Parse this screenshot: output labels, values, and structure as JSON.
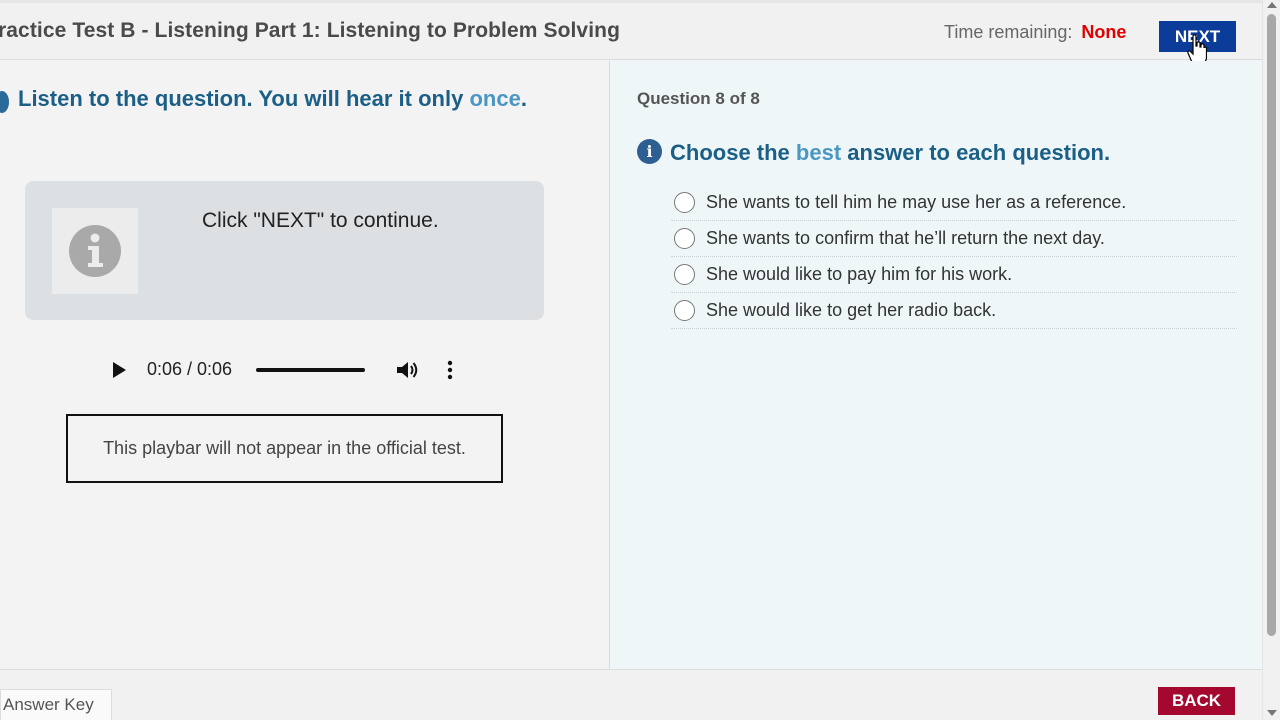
{
  "header": {
    "title": "ractice Test B - Listening Part 1: Listening to Problem Solving",
    "time_label": "Time remaining:",
    "time_value": "None",
    "next_label": "NEXT"
  },
  "left": {
    "instruction_prefix": "Listen to the question. You will hear it only ",
    "instruction_highlight": "once",
    "instruction_suffix": ".",
    "info_box_text": "Click \"NEXT\" to continue.",
    "audio_time": "0:06 / 0:06",
    "audio_progress": 1.0,
    "playbar_note": "This playbar will not appear in the official test."
  },
  "right": {
    "question_counter": "Question 8 of 8",
    "choose_prefix": "Choose the ",
    "choose_highlight": "best",
    "choose_suffix": " answer to each question.",
    "answers": [
      {
        "text": "She wants to tell him he may use her as a reference."
      },
      {
        "text": "She wants to confirm that he’ll return the next day."
      },
      {
        "text": "She would like to pay him for his work."
      },
      {
        "text": "She would like to get her radio back."
      }
    ]
  },
  "footer": {
    "answer_key_label": "Answer Key",
    "back_label": "BACK"
  },
  "colors": {
    "next_button": "#0c3c9a",
    "back_button": "#a4082e",
    "time_value": "#e00000",
    "instruction": "#1b5f86",
    "highlight": "#4b97c2"
  },
  "icons": {
    "info": "info-icon",
    "play": "play-icon",
    "volume": "volume-icon",
    "more": "more-options-icon",
    "cursor": "hand-cursor-icon"
  }
}
